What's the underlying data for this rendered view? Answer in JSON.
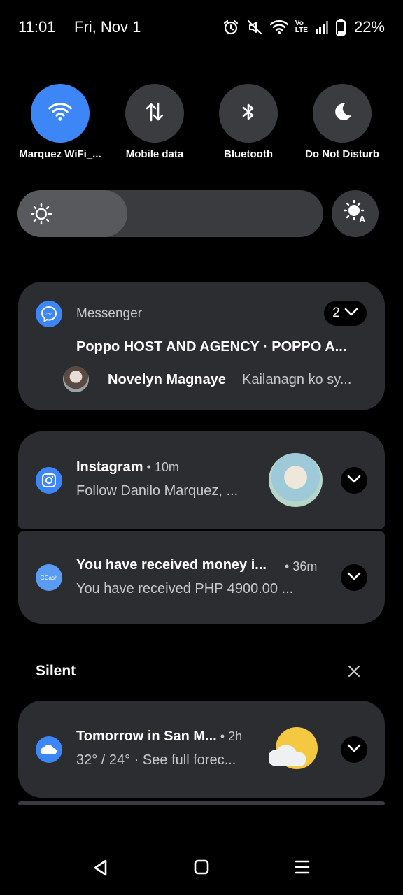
{
  "status_bar": {
    "time": "11:01",
    "date": "Fri, Nov 1",
    "icons": [
      "alarm-icon",
      "mute-icon",
      "wifi-icon",
      "volte-icon",
      "signal-icon",
      "battery-icon"
    ],
    "volte_top": "Vo",
    "volte_bottom": "LTE",
    "battery": "22%"
  },
  "quick_settings": [
    {
      "label": "Marquez WiFi_...",
      "icon": "wifi-icon",
      "active": true
    },
    {
      "label": "Mobile data",
      "icon": "mobile-data-icon",
      "active": false
    },
    {
      "label": "Bluetooth",
      "icon": "bluetooth-icon",
      "active": false
    },
    {
      "label": "Do Not Disturb",
      "icon": "moon-icon",
      "active": false
    }
  ],
  "brightness": {
    "level_percent": 36,
    "auto_icon": "auto-brightness-icon"
  },
  "notifications": {
    "messenger": {
      "app": "Messenger",
      "count": "2",
      "title": "Poppo HOST AND AGENCY · POPPO A...",
      "sender": "Novelyn Magnaye",
      "text": "Kailanagn ko sy..."
    },
    "instagram": {
      "title": "Instagram",
      "meta": " • 10m",
      "text": "Follow Danilo Marquez, ..."
    },
    "gcash": {
      "icon_text": "GCash",
      "title": "You have received money i...",
      "time": "• 36m",
      "text": "You have received PHP 4900.00 ..."
    },
    "silent_header": "Silent",
    "weather": {
      "title": "Tomorrow in San M...",
      "meta": " • 2h",
      "text": "32° / 24° · See full forec..."
    }
  },
  "colors": {
    "accent": "#3d86f6",
    "card": "#2c2d31",
    "background": "#000000"
  }
}
